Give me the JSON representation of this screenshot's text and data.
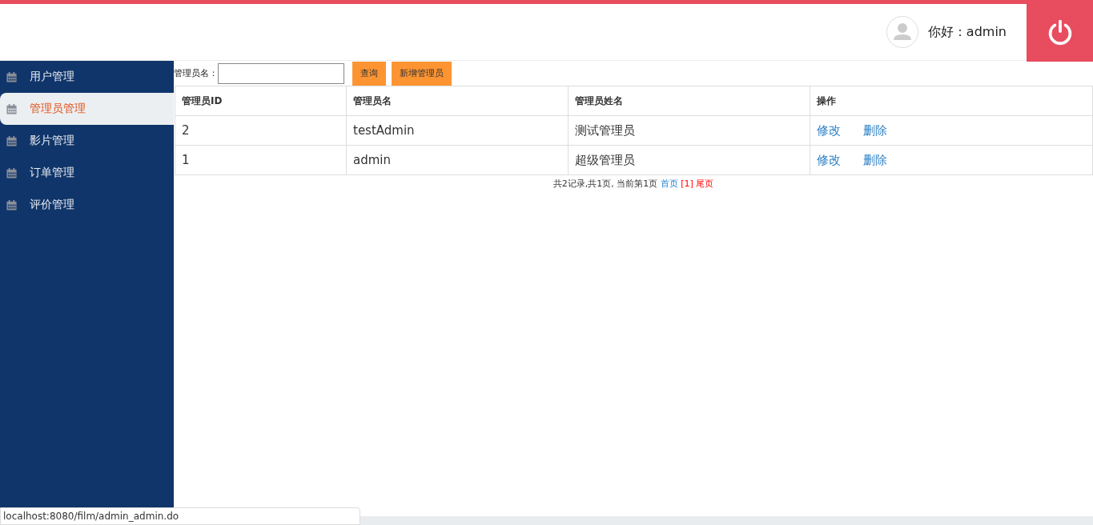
{
  "header": {
    "greeting": "你好：admin"
  },
  "sidebar": {
    "items": [
      {
        "label": "用户管理",
        "selected": false
      },
      {
        "label": "管理员管理",
        "selected": true
      },
      {
        "label": "影片管理",
        "selected": false
      },
      {
        "label": "订单管理",
        "selected": false
      },
      {
        "label": "评价管理",
        "selected": false
      }
    ]
  },
  "search": {
    "label": "管理员名：",
    "query_button": "查询",
    "add_button": "新增管理员"
  },
  "table": {
    "columns": [
      "管理员ID",
      "管理员名",
      "管理员姓名",
      "操作"
    ],
    "rows": [
      {
        "cells": [
          "2",
          "testAdmin",
          "测试管理员"
        ],
        "actions": [
          "修改",
          "删除"
        ]
      },
      {
        "cells": [
          "1",
          "admin",
          "超级管理员"
        ],
        "actions": [
          "修改",
          "删除"
        ]
      }
    ]
  },
  "pagination": {
    "summary": "共2记录,共1页, 当前第1页",
    "first": "首页",
    "current": "[1]",
    "last": "尾页"
  },
  "status_bar": {
    "url": "localhost:8080/film/admin_admin.do"
  }
}
